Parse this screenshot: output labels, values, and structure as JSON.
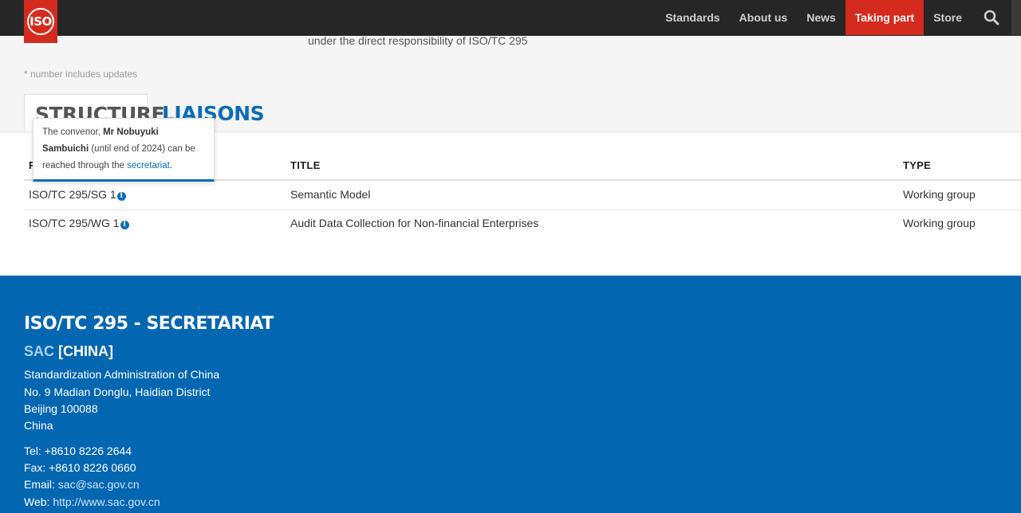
{
  "nav": {
    "logo": "ISO",
    "items": [
      "Standards",
      "About us",
      "News",
      "Taking part",
      "Store"
    ],
    "active": "Taking part",
    "search_icon": "search-icon"
  },
  "intro": {
    "truncated_text": "under the direct responsibility of ISO/TC 295",
    "footnote": "* number includes updates"
  },
  "tabs": {
    "structure": "STRUCTURE",
    "liaisons": "LIAISONS"
  },
  "tooltip": {
    "prefix": "The convenor, ",
    "name": "Mr Nobuyuki Sambuichi",
    "middle": " (until end of 2024) can be reached through the ",
    "link": "secretariat",
    "suffix": "."
  },
  "table": {
    "headers": {
      "reference": "R",
      "title": "TITLE",
      "type": "TYPE"
    },
    "rows": [
      {
        "reference": "ISO/TC 295/SG 1",
        "title": "Semantic Model",
        "type": "Working group"
      },
      {
        "reference": "ISO/TC 295/WG 1",
        "title": "Audit Data Collection for Non-financial Enterprises",
        "type": "Working group"
      }
    ]
  },
  "footer": {
    "title": "ISO/TC 295 - SECRETARIAT",
    "acronym": "SAC",
    "country": " [CHINA]",
    "address": [
      "Standardization Administration of China",
      "No. 9 Madian Donglu, Haidian District",
      "Beijing 100088",
      "China"
    ],
    "tel_label": "Tel: ",
    "tel": "+8610 8226 2644",
    "fax_label": "Fax: ",
    "fax": "+8610 8226 0660",
    "email_label": "Email: ",
    "email": "sac@sac.gov.cn",
    "web_label": "Web: ",
    "web": "http://www.sac.gov.cn"
  },
  "colors": {
    "nav_bg": "#262626",
    "accent_red": "#d52b1e",
    "link_blue": "#0b6cb8",
    "footer_blue": "#0266b1"
  }
}
